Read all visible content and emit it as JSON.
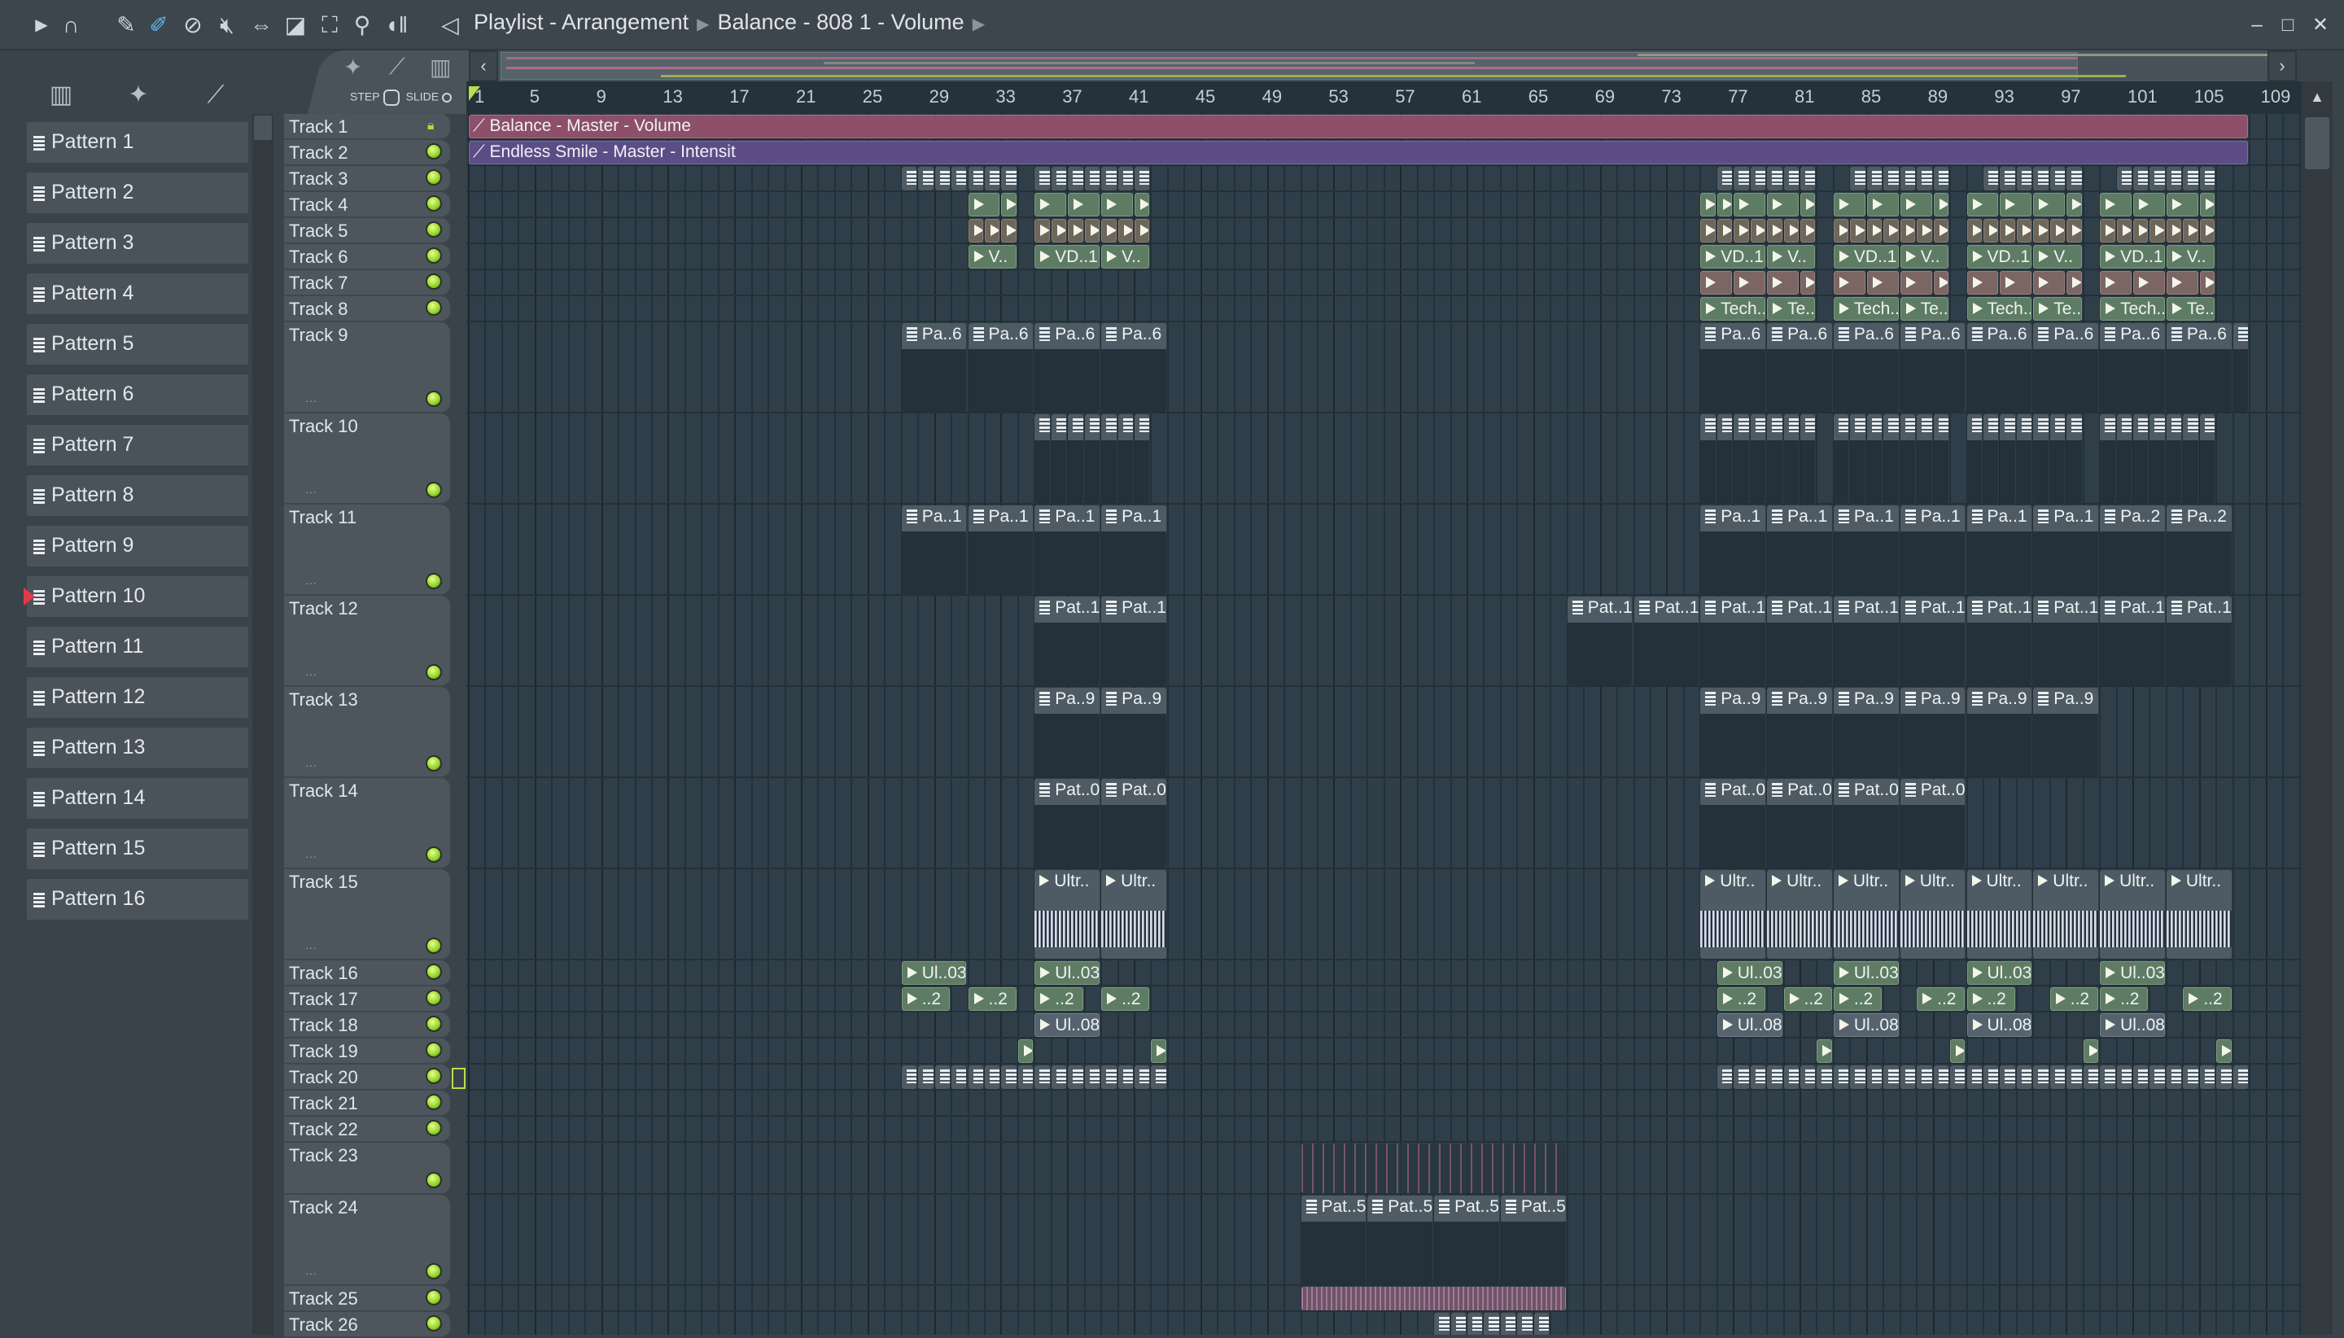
{
  "toolbar": {
    "icons": [
      "play-arrow",
      "magnet",
      "pencil",
      "paint-brush",
      "delete",
      "mute",
      "slip",
      "slice",
      "select",
      "zoom",
      "playback",
      "speaker"
    ],
    "title": "Playlist - Arrangement",
    "breadcrumb": "Balance - 808 1 - Volume"
  },
  "window_controls": {
    "minimize": "–",
    "maximize": "□",
    "close": "✕"
  },
  "step_slide": {
    "step": "STEP",
    "slide": "SLIDE"
  },
  "patterns": [
    "Pattern 1",
    "Pattern 2",
    "Pattern 3",
    "Pattern 4",
    "Pattern 5",
    "Pattern 6",
    "Pattern 7",
    "Pattern 8",
    "Pattern 9",
    "Pattern 10",
    "Pattern 11",
    "Pattern 12",
    "Pattern 13",
    "Pattern 14",
    "Pattern 15",
    "Pattern 16"
  ],
  "selected_pattern": "Pattern 10",
  "ruler": [
    "1",
    "5",
    "9",
    "13",
    "17",
    "21",
    "25",
    "29",
    "33",
    "37",
    "41",
    "45",
    "49",
    "53",
    "57",
    "61",
    "65",
    "69",
    "73",
    "77",
    "81",
    "85",
    "89",
    "93",
    "97",
    "101",
    "105",
    "109"
  ],
  "tracks": [
    "Track 1",
    "Track 2",
    "Track 3",
    "Track 4",
    "Track 5",
    "Track 6",
    "Track 7",
    "Track 8",
    "Track 9",
    "Track 10",
    "Track 11",
    "Track 12",
    "Track 13",
    "Track 14",
    "Track 15",
    "Track 16",
    "Track 17",
    "Track 18",
    "Track 19",
    "Track 20",
    "Track 21",
    "Track 22",
    "Track 23",
    "Track 24",
    "Track 25",
    "Track 26"
  ],
  "clip_groups": [
    {
      "track": 1,
      "kind": "autopink",
      "label": "Balance - Master - Volume",
      "len": 107,
      "starts": [
        1
      ]
    },
    {
      "track": 2,
      "kind": "autopurple",
      "label": "Endless Smile - Master - Intensit",
      "len": 107,
      "starts": [
        1
      ]
    },
    {
      "track": 3,
      "kind": "pat",
      "label": "",
      "len": 1,
      "starts": [
        27,
        28,
        29,
        30,
        31,
        32,
        33,
        35,
        36,
        37,
        38,
        39,
        40,
        41,
        76,
        77,
        78,
        79,
        80,
        81,
        84,
        85,
        86,
        87,
        88,
        89,
        92,
        93,
        94,
        95,
        96,
        97,
        100,
        101,
        102,
        103,
        104,
        105
      ]
    },
    {
      "track": 4,
      "kind": "green",
      "label": "",
      "len": 2,
      "starts": [
        31,
        35,
        37,
        39,
        77,
        79,
        83,
        85,
        87,
        91,
        93,
        95,
        99,
        101,
        103
      ]
    },
    {
      "track": 4,
      "kind": "green",
      "label": "",
      "len": 1,
      "starts": [
        33,
        41,
        75,
        76,
        81,
        89,
        97,
        105
      ]
    },
    {
      "track": 5,
      "kind": "brown",
      "label": "",
      "len": 1,
      "starts": [
        31,
        32,
        33,
        35,
        36,
        37,
        38,
        39,
        40,
        41,
        75,
        76,
        77,
        78,
        79,
        80,
        81,
        83,
        84,
        85,
        86,
        87,
        88,
        89,
        91,
        92,
        93,
        94,
        95,
        96,
        97,
        99,
        100,
        101,
        102,
        103,
        104,
        105
      ]
    },
    {
      "track": 6,
      "kind": "green",
      "label": "V..",
      "len": 3,
      "starts": [
        31,
        39,
        79,
        87,
        95,
        103
      ]
    },
    {
      "track": 6,
      "kind": "green",
      "label": "VD..1",
      "len": 4,
      "starts": [
        35,
        75,
        83,
        91,
        99
      ]
    },
    {
      "track": 7,
      "kind": "rose",
      "label": "",
      "len": 2,
      "starts": [
        75,
        77,
        79,
        83,
        85,
        87,
        91,
        93,
        95,
        99,
        101,
        103
      ]
    },
    {
      "track": 7,
      "kind": "rose",
      "label": "",
      "len": 1,
      "starts": [
        81,
        89,
        97,
        105
      ]
    },
    {
      "track": 8,
      "kind": "green",
      "label": "Tech..",
      "len": 4,
      "starts": [
        75,
        83,
        91,
        99
      ]
    },
    {
      "track": 8,
      "kind": "green",
      "label": "Te..",
      "len": 3,
      "starts": [
        79,
        87,
        95,
        103
      ]
    },
    {
      "track": 9,
      "kind": "pat",
      "label": "Pa..6",
      "len": 4,
      "starts": [
        27,
        31,
        35,
        39,
        75,
        79,
        83,
        87,
        91,
        95,
        99,
        103
      ]
    },
    {
      "track": 9,
      "kind": "pat",
      "label": "",
      "len": 1,
      "starts": [
        107
      ]
    },
    {
      "track": 10,
      "kind": "pat",
      "label": "",
      "len": 1,
      "starts": [
        35,
        36,
        37,
        38,
        39,
        40,
        41,
        75,
        76,
        77,
        78,
        79,
        80,
        81,
        83,
        84,
        85,
        86,
        87,
        88,
        89,
        91,
        92,
        93,
        94,
        95,
        96,
        97,
        99,
        100,
        101,
        102,
        103,
        104,
        105
      ]
    },
    {
      "track": 11,
      "kind": "pat",
      "label": "Pa..1",
      "len": 4,
      "starts": [
        27,
        31,
        35,
        39,
        75,
        79,
        83,
        87,
        91,
        95
      ]
    },
    {
      "track": 11,
      "kind": "pat",
      "label": "Pa..2",
      "len": 4,
      "starts": [
        99,
        103
      ]
    },
    {
      "track": 12,
      "kind": "pat",
      "label": "Pat..1",
      "len": 4,
      "starts": [
        35,
        39,
        67,
        71,
        75,
        79,
        83,
        87,
        91,
        95,
        99,
        103
      ]
    },
    {
      "track": 13,
      "kind": "pat",
      "label": "Pa..9",
      "len": 4,
      "starts": [
        35,
        39,
        75,
        79,
        83,
        87,
        91,
        95
      ]
    },
    {
      "track": 14,
      "kind": "pat",
      "label": "Pat..0",
      "len": 4,
      "starts": [
        35,
        39,
        75,
        79,
        83,
        87
      ]
    },
    {
      "track": 15,
      "kind": "wave",
      "label": "Ultr..",
      "len": 4,
      "starts": [
        35,
        39,
        75,
        79,
        83,
        87,
        91,
        95,
        99,
        103
      ]
    },
    {
      "track": 16,
      "kind": "green",
      "label": "Ul..03",
      "len": 4,
      "starts": [
        27,
        35,
        76,
        83,
        91,
        99
      ]
    },
    {
      "track": 17,
      "kind": "green",
      "label": "..2",
      "len": 3,
      "starts": [
        27,
        31,
        35,
        39,
        76,
        80,
        83,
        88,
        91,
        96,
        99,
        104
      ]
    },
    {
      "track": 18,
      "kind": "slate",
      "label": "Ul..08",
      "len": 4,
      "starts": [
        35,
        76,
        83,
        91,
        99
      ]
    },
    {
      "track": 19,
      "kind": "green",
      "label": "",
      "len": 1,
      "starts": [
        34,
        42,
        82,
        90,
        98,
        106
      ]
    },
    {
      "track": 20,
      "kind": "pat",
      "label": "",
      "len": 1,
      "starts": [
        27,
        28,
        29,
        30,
        31,
        32,
        33,
        34,
        35,
        36,
        37,
        38,
        39,
        40,
        41,
        42,
        76,
        77,
        78,
        79,
        80,
        81,
        82,
        83,
        84,
        85,
        86,
        87,
        88,
        89,
        90,
        91,
        92,
        93,
        94,
        95,
        96,
        97,
        98,
        99,
        100,
        101,
        102,
        103,
        104,
        105,
        106,
        107
      ]
    },
    {
      "track": 23,
      "kind": "ghost",
      "label": "",
      "len": 16,
      "starts": [
        51
      ]
    },
    {
      "track": 24,
      "kind": "pat",
      "label": "Pat..5",
      "len": 4,
      "starts": [
        51,
        55,
        59,
        63
      ]
    },
    {
      "track": 25,
      "kind": "rosewave",
      "label": "",
      "len": 16,
      "starts": [
        51
      ]
    },
    {
      "track": 26,
      "kind": "pat",
      "label": "",
      "len": 1,
      "starts": [
        59,
        60,
        61,
        62,
        63,
        64,
        65
      ]
    }
  ],
  "colors": {
    "grid_bg": "#2f3e48",
    "auto_pink": "#8d4f69",
    "auto_purple": "#5d4d86",
    "audio_green": "#5e7c63",
    "track_led": "#8fd42a",
    "selected_marker": "#e23a4a"
  }
}
